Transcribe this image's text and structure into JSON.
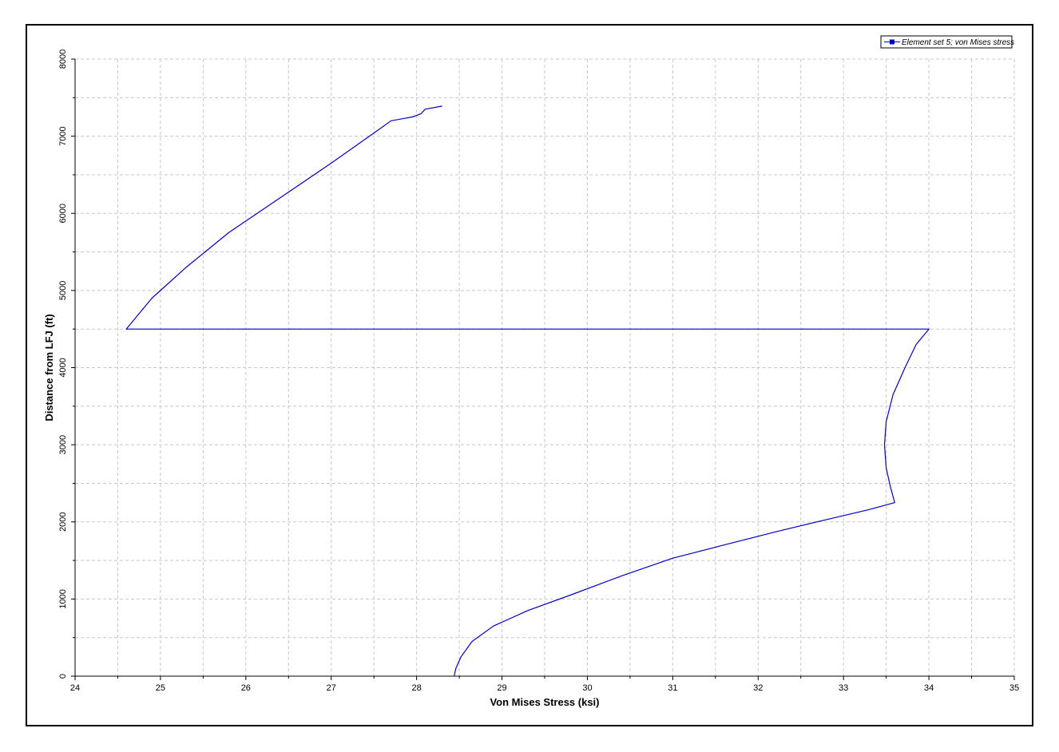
{
  "chart_data": {
    "type": "line",
    "title": "",
    "xlabel": "Von Mises Stress (ksi)",
    "ylabel": "Distance from LFJ (ft)",
    "xlim": [
      24,
      35
    ],
    "ylim": [
      0,
      8000
    ],
    "x_ticks": [
      24,
      25,
      26,
      27,
      28,
      29,
      30,
      31,
      32,
      33,
      34,
      35
    ],
    "y_ticks": [
      0,
      1000,
      2000,
      3000,
      4000,
      5000,
      6000,
      7000,
      8000
    ],
    "grid": true,
    "legend_position": "top-right",
    "series": [
      {
        "name": "Element set  5; von Mises stress",
        "color": "#0000cc",
        "points": [
          [
            28.44,
            0
          ],
          [
            28.46,
            100
          ],
          [
            28.52,
            250
          ],
          [
            28.65,
            450
          ],
          [
            28.9,
            650
          ],
          [
            29.3,
            850
          ],
          [
            29.8,
            1050
          ],
          [
            30.4,
            1300
          ],
          [
            31.0,
            1530
          ],
          [
            31.6,
            1700
          ],
          [
            32.2,
            1870
          ],
          [
            32.8,
            2030
          ],
          [
            33.3,
            2160
          ],
          [
            33.6,
            2250
          ],
          [
            33.55,
            2450
          ],
          [
            33.5,
            2700
          ],
          [
            33.48,
            3000
          ],
          [
            33.5,
            3300
          ],
          [
            33.58,
            3650
          ],
          [
            33.72,
            4000
          ],
          [
            33.85,
            4300
          ],
          [
            34.0,
            4500
          ],
          [
            24.6,
            4500
          ],
          [
            24.9,
            4900
          ],
          [
            25.3,
            5300
          ],
          [
            25.8,
            5750
          ],
          [
            26.4,
            6200
          ],
          [
            27.0,
            6650
          ],
          [
            27.55,
            7080
          ],
          [
            27.7,
            7200
          ],
          [
            27.95,
            7250
          ],
          [
            28.05,
            7290
          ],
          [
            28.1,
            7350
          ],
          [
            28.3,
            7390
          ]
        ]
      }
    ]
  }
}
